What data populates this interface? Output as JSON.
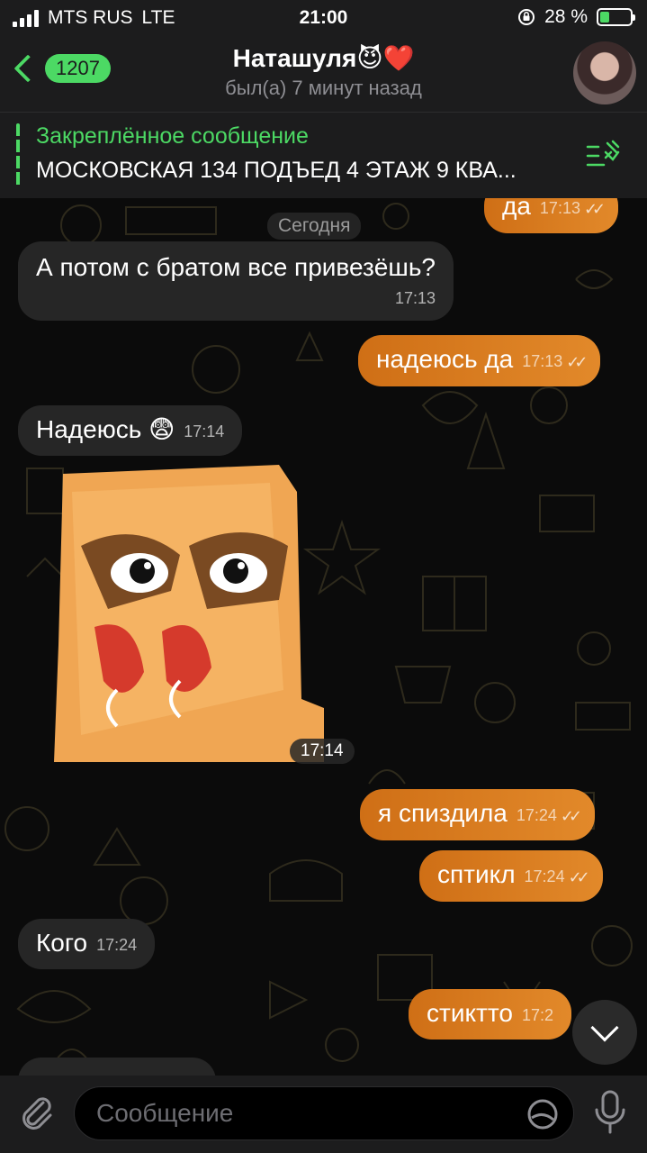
{
  "status_bar": {
    "carrier": "MTS RUS",
    "network": "LTE",
    "time": "21:00",
    "battery": "28 %"
  },
  "header": {
    "back_count": "1207",
    "title": "Наташуля😈❤️",
    "subtitle": "был(а) 7 минут назад"
  },
  "pinned": {
    "label": "Закреплённое сообщение",
    "text": "МОСКОВСКАЯ 134 ПОДЪЕД 4 ЭТАЖ 9 КВА..."
  },
  "chat": {
    "date_separator": "Сегодня",
    "messages": [
      {
        "text": "да",
        "time": "17:13",
        "dir": "out"
      },
      {
        "text": "А потом с братом все привезёшь?",
        "time": "17:13",
        "dir": "in"
      },
      {
        "text": "надеюсь да",
        "time": "17:13",
        "dir": "out"
      },
      {
        "text": "Надеюсь 😨",
        "time": "17:14",
        "dir": "in"
      },
      {
        "text": "",
        "time": "17:14",
        "dir": "in",
        "type": "sticker"
      },
      {
        "text": "я спиздила",
        "time": "17:24",
        "dir": "out"
      },
      {
        "text": "сптикл",
        "time": "17:24",
        "dir": "out"
      },
      {
        "text": "Кого",
        "time": "17:24",
        "dir": "in"
      },
      {
        "text": "стиктто",
        "time": "17:2",
        "dir": "out"
      }
    ]
  },
  "input": {
    "placeholder": "Сообщение"
  },
  "colors": {
    "accent": "#4cd964",
    "outgoing": "#d9771e",
    "incoming": "#262626"
  }
}
